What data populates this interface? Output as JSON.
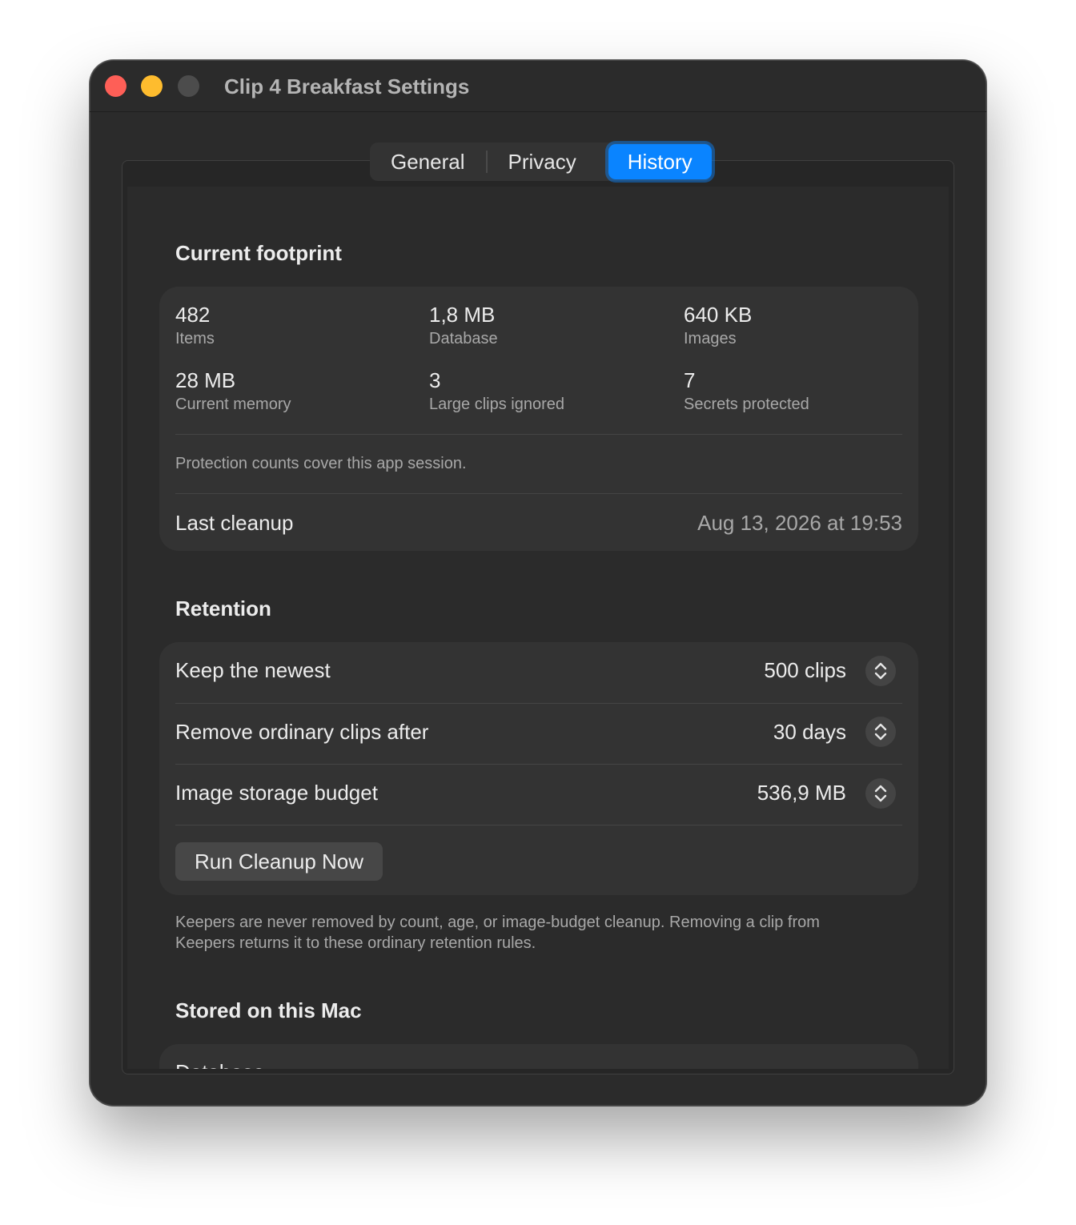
{
  "window": {
    "title": "Clip 4 Breakfast Settings"
  },
  "tabs": [
    {
      "label": "General"
    },
    {
      "label": "Privacy"
    },
    {
      "label": "History",
      "active": true
    }
  ],
  "footprint": {
    "title": "Current footprint",
    "stats": [
      {
        "value": "482",
        "label": "Items"
      },
      {
        "value": "1,8 MB",
        "label": "Database"
      },
      {
        "value": "640 KB",
        "label": "Images"
      },
      {
        "value": "28 MB",
        "label": "Current memory"
      },
      {
        "value": "3",
        "label": "Large clips ignored"
      },
      {
        "value": "7",
        "label": "Secrets protected"
      }
    ],
    "note": "Protection counts cover this app session.",
    "last_cleanup_label": "Last cleanup",
    "last_cleanup_value": "Aug 13, 2026 at 19:53"
  },
  "retention": {
    "title": "Retention",
    "rows": [
      {
        "label": "Keep the newest",
        "value": "500 clips"
      },
      {
        "label": "Remove ordinary clips after",
        "value": "30 days"
      },
      {
        "label": "Image storage budget",
        "value": "536,9 MB"
      }
    ],
    "button_label": "Run Cleanup Now",
    "note_line1": "Keepers are never removed by count, age, or image-budget cleanup. Removing a clip from",
    "note_line2": "Keepers returns it to these ordinary retention rules."
  },
  "stored": {
    "title": "Stored on this Mac",
    "first_row_label": "Database"
  },
  "colors": {
    "accent": "#0a84ff",
    "window_bg": "#2b2b2b",
    "card_bg": "#333333",
    "close": "#fe5f57",
    "minimize": "#febc2e"
  }
}
